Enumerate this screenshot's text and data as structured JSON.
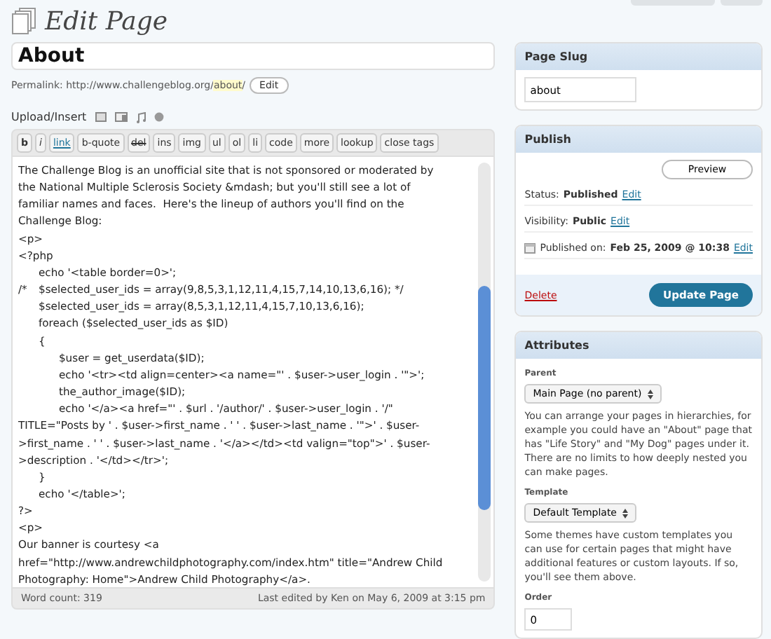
{
  "header": {
    "title": "Edit Page"
  },
  "title_field": {
    "value": "About"
  },
  "permalink": {
    "label": "Permalink:",
    "url_base": "http://www.challengeblog.org/",
    "slug": "about",
    "url_end": "/",
    "button": "Edit"
  },
  "upload": {
    "label": "Upload/Insert"
  },
  "toolbar": [
    {
      "label": "b",
      "kind": "bold"
    },
    {
      "label": "i",
      "kind": "italic"
    },
    {
      "label": "link",
      "kind": "link"
    },
    {
      "label": "b-quote",
      "kind": "plain"
    },
    {
      "label": "del",
      "kind": "strike"
    },
    {
      "label": "ins",
      "kind": "plain"
    },
    {
      "label": "img",
      "kind": "plain"
    },
    {
      "label": "ul",
      "kind": "plain"
    },
    {
      "label": "ol",
      "kind": "plain"
    },
    {
      "label": "li",
      "kind": "plain"
    },
    {
      "label": "code",
      "kind": "plain"
    },
    {
      "label": "more",
      "kind": "plain"
    },
    {
      "label": "lookup",
      "kind": "plain"
    },
    {
      "label": "close tags",
      "kind": "plain"
    }
  ],
  "editor": {
    "lines": [
      "The Challenge Blog is an unofficial site that is not sponsored or moderated by",
      "the National Multiple Sclerosis Society &mdash; but you'll still see a lot of",
      "familiar names and faces.  Here's the lineup of authors you'll find on the",
      "Challenge Blog:",
      "<p>",
      "<?php",
      "\techo '<table border=0>';",
      "/*\t$selected_user_ids = array(9,8,5,3,1,12,11,4,15,7,14,10,13,6,16); */",
      "\t$selected_user_ids = array(8,5,3,1,12,11,4,15,7,10,13,6,16);",
      "\tforeach ($selected_user_ids as $ID)",
      "\t{",
      "\t\t$user = get_userdata($ID);",
      "\t\techo '<tr><td align=center><a name=\"' . $user->user_login . '\">';",
      "\t\tthe_author_image($ID);",
      "\t\techo '</a><a href=\"' . $url . '/author/' . $user->user_login . '/\"",
      "TITLE=\"Posts by ' . $user->first_name . ' ' . $user->last_name . '\">' . $user-",
      ">first_name . ' ' . $user->last_name . '</a></td><td valign=\"top\">' . $user-",
      ">description . '</td></tr>';",
      "\t}",
      "\techo '</table>';",
      "?>",
      "<p>",
      "Our banner is courtesy <a",
      "href=\"http://www.andrewchildphotography.com/index.htm\" title=\"Andrew Child",
      "Photography: Home\">Andrew Child Photography</a>."
    ],
    "word_count": "Word count: 319",
    "last_edited": "Last edited by Ken on May 6, 2009 at 3:15 pm"
  },
  "page_slug": {
    "title": "Page Slug",
    "value": "about"
  },
  "publish": {
    "title": "Publish",
    "preview": "Preview",
    "rows": [
      {
        "label": "Status:",
        "value": "Published",
        "link": "Edit",
        "kind": "plain"
      },
      {
        "label": "Visibility:",
        "value": "Public",
        "link": "Edit",
        "kind": "plain"
      },
      {
        "label": "Published on:",
        "value": "Feb 25, 2009 @ 10:38",
        "link": "Edit",
        "kind": "date"
      }
    ],
    "delete": "Delete",
    "update": "Update Page"
  },
  "attributes": {
    "title": "Attributes",
    "parent_label": "Parent",
    "parent_value": "Main Page (no parent)",
    "parent_help": "You can arrange your pages in hierarchies, for example you could have an \"About\" page that has \"Life Story\" and \"My Dog\" pages under it. There are no limits to how deeply nested you can make pages.",
    "template_label": "Template",
    "template_value": "Default Template",
    "template_help": "Some themes have custom templates you can use for certain pages that might have additional features or custom layouts. If so, you'll see them above.",
    "order_label": "Order",
    "order_value": "0"
  }
}
